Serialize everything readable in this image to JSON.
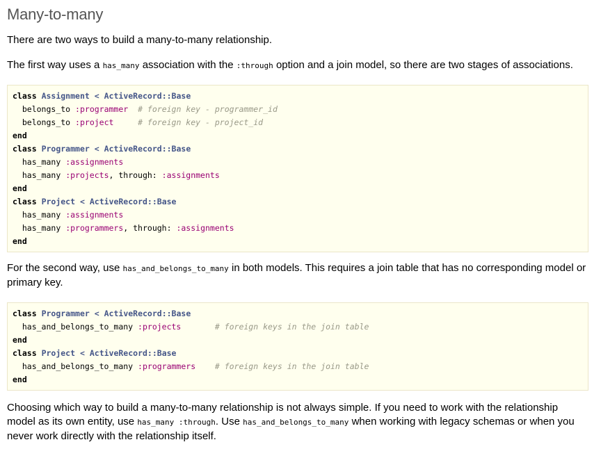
{
  "heading": "Many-to-many",
  "intro": "There are two ways to build a many-to-many relationship.",
  "para_first": {
    "t1": "The first way uses a ",
    "code1": "has_many",
    "t2": " association with the ",
    "code2": ":through",
    "t3": " option and a join model, so there are two stages of associations."
  },
  "code1": {
    "l1": {
      "kw": "class",
      "name": "Assignment",
      "lt": "<",
      "base": "ActiveRecord::Base"
    },
    "l2": {
      "method": "belongs_to",
      "sym": ":programmer",
      "pad": "  ",
      "comment": "# foreign key - programmer_id"
    },
    "l3": {
      "method": "belongs_to",
      "sym": ":project",
      "pad": "     ",
      "comment": "# foreign key - project_id"
    },
    "l4": {
      "kw": "end"
    },
    "l5": {
      "kw": "class",
      "name": "Programmer",
      "lt": "<",
      "base": "ActiveRecord::Base"
    },
    "l6": {
      "method": "has_many",
      "sym": ":assignments"
    },
    "l7": {
      "method": "has_many",
      "sym": ":projects",
      "sep": ", through: ",
      "sym2": ":assignments"
    },
    "l8": {
      "kw": "end"
    },
    "l9": {
      "kw": "class",
      "name": "Project",
      "lt": "<",
      "base": "ActiveRecord::Base"
    },
    "l10": {
      "method": "has_many",
      "sym": ":assignments"
    },
    "l11": {
      "method": "has_many",
      "sym": ":programmers",
      "sep": ", through: ",
      "sym2": ":assignments"
    },
    "l12": {
      "kw": "end"
    }
  },
  "para_second": {
    "t1": "For the second way, use ",
    "code1": "has_and_belongs_to_many",
    "t2": " in both models. This requires a join table that has no corresponding model or primary key."
  },
  "code2": {
    "l1": {
      "kw": "class",
      "name": "Programmer",
      "lt": "<",
      "base": "ActiveRecord::Base"
    },
    "l2": {
      "method": "has_and_belongs_to_many",
      "sym": ":projects",
      "pad": "       ",
      "comment": "# foreign keys in the join table"
    },
    "l3": {
      "kw": "end"
    },
    "l4": {
      "kw": "class",
      "name": "Project",
      "lt": "<",
      "base": "ActiveRecord::Base"
    },
    "l5": {
      "method": "has_and_belongs_to_many",
      "sym": ":programmers",
      "pad": "    ",
      "comment": "# foreign keys in the join table"
    },
    "l6": {
      "kw": "end"
    }
  },
  "para_choose": {
    "t1": "Choosing which way to build a many-to-many relationship is not always simple. If you need to work with the relationship model as its own entity, use ",
    "code1": "has_many :through",
    "t2": ". Use ",
    "code2": "has_and_belongs_to_many",
    "t3": " when working with legacy schemas or when you never work directly with the relationship itself."
  },
  "colors": {
    "heading": "#555555",
    "code_bg": "#ffffee",
    "code_border": "#ebe6c8",
    "class_name": "#445588",
    "symbol": "#990073",
    "comment": "#999988"
  }
}
